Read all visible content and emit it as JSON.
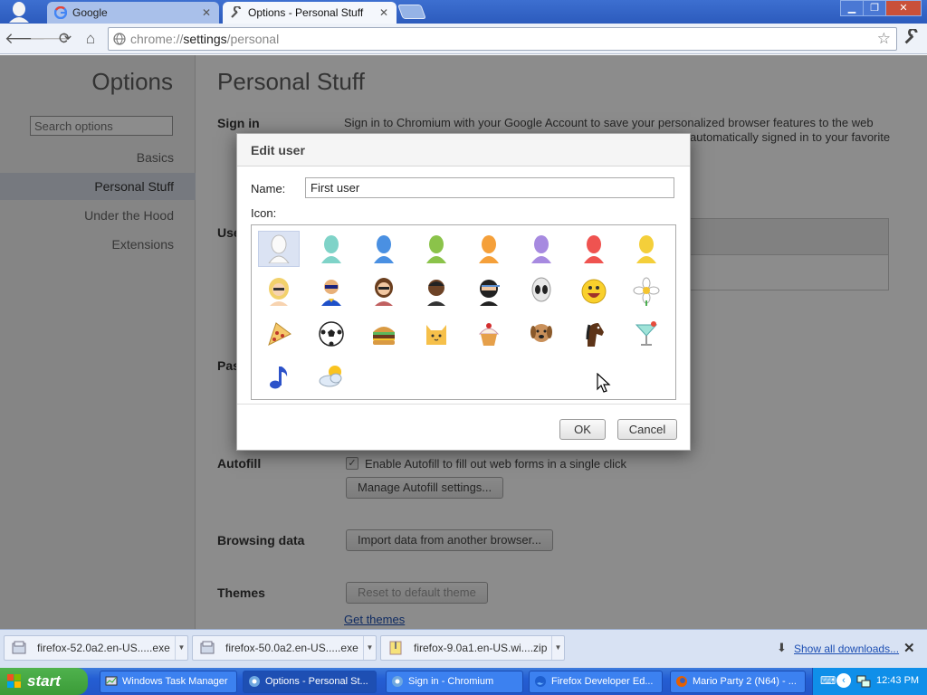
{
  "browser": {
    "tabs": [
      {
        "title": "Google",
        "favicon": "google-icon"
      },
      {
        "title": "Options - Personal Stuff",
        "favicon": "wrench-icon"
      }
    ],
    "window_controls": {
      "minimize": "▁",
      "maximize": "❐",
      "close": "✕"
    }
  },
  "toolbar": {
    "url_scheme": "chrome://",
    "url_host": "settings",
    "url_path": "/personal"
  },
  "sidebar": {
    "title": "Options",
    "search_placeholder": "Search options",
    "items": [
      "Basics",
      "Personal Stuff",
      "Under the Hood",
      "Extensions"
    ],
    "active": "Personal Stuff"
  },
  "main": {
    "title": "Personal Stuff",
    "sign_in": {
      "label": "Sign in",
      "desc_line1": "Sign in to Chromium with your Google Account to save your personalized browser features to the web",
      "desc_line2": "automatically signed in to your favorite"
    },
    "users_label": "Use",
    "passwords_label": "Pas",
    "autofill": {
      "label": "Autofill",
      "checkbox_label": "Enable Autofill to fill out web forms in a single click",
      "checked": true,
      "button": "Manage Autofill settings..."
    },
    "browsing_data": {
      "label": "Browsing data",
      "button": "Import data from another browser..."
    },
    "themes": {
      "label": "Themes",
      "button": "Reset to default theme",
      "link": "Get themes"
    }
  },
  "dialog": {
    "title": "Edit user",
    "name_label": "Name:",
    "name_value": "First user",
    "icon_label": "Icon:",
    "icons": [
      "avatar-white-icon",
      "avatar-teal-icon",
      "avatar-blue-icon",
      "avatar-green-icon",
      "avatar-orange-icon",
      "avatar-purple-icon",
      "avatar-red-icon",
      "avatar-yellow-icon",
      "blonde-woman-icon",
      "superhero-icon",
      "woman-sunglasses-icon",
      "man-icon",
      "ninja-icon",
      "alien-icon",
      "smiley-icon",
      "flower-icon",
      "pizza-icon",
      "soccer-ball-icon",
      "hamburger-icon",
      "cat-icon",
      "cupcake-icon",
      "dog-icon",
      "horse-icon",
      "cocktail-icon",
      "music-note-icon",
      "sun-cloud-icon"
    ],
    "selected_icon": 0,
    "ok": "OK",
    "cancel": "Cancel"
  },
  "downloads": {
    "items": [
      "firefox-52.0a2.en-US.....exe",
      "firefox-50.0a2.en-US.....exe",
      "firefox-9.0a1.en-US.wi....zip"
    ],
    "show_all": "Show all downloads..."
  },
  "taskbar": {
    "start": "start",
    "tasks": [
      "Windows Task Manager",
      "Options - Personal St...",
      "Sign in - Chromium",
      "Firefox Developer Ed...",
      "Mario Party 2 (N64) - ..."
    ],
    "active_task": 1,
    "clock": "12:43 PM"
  },
  "colors": {
    "tabstrip": "#2c5bbd",
    "link": "#1d4fb3",
    "taskbar": "#245ed3",
    "start": "#3b9b38"
  }
}
